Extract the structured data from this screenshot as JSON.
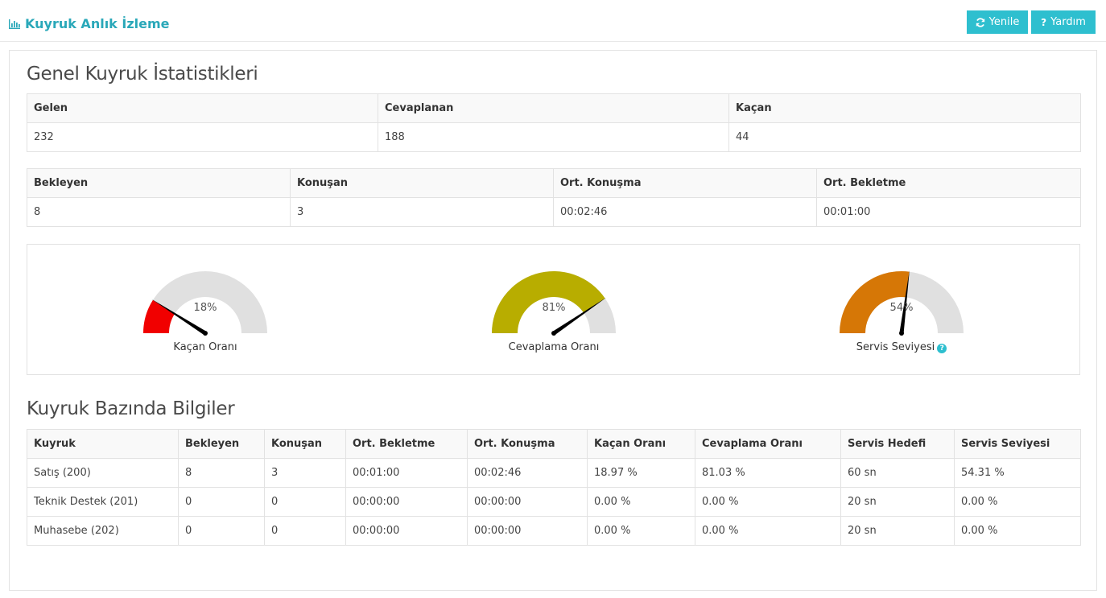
{
  "header": {
    "title": "Kuyruk Anlık İzleme",
    "title_icon": "bar-chart-icon",
    "refresh_label": "Yenile",
    "help_label": "Yardım"
  },
  "general": {
    "title": "Genel Kuyruk İstatistikleri",
    "table1": {
      "headers": [
        "Gelen",
        "Cevaplanan",
        "Kaçan"
      ],
      "values": [
        "232",
        "188",
        "44"
      ]
    },
    "table2": {
      "headers": [
        "Bekleyen",
        "Konuşan",
        "Ort. Konuşma",
        "Ort. Bekletme"
      ],
      "values": [
        "8",
        "3",
        "00:02:46",
        "00:01:00"
      ]
    }
  },
  "gauges": [
    {
      "label": "Kaçan Oranı",
      "value_text": "18%",
      "value": 0.18,
      "color": "#f10000",
      "has_help": false
    },
    {
      "label": "Cevaplama Oranı",
      "value_text": "81%",
      "value": 0.81,
      "color": "#b8ad00",
      "has_help": false
    },
    {
      "label": "Servis Seviyesi",
      "value_text": "54%",
      "value": 0.54,
      "color": "#d67706",
      "has_help": true
    }
  ],
  "gauge_track_color": "#e0e0e0",
  "queue": {
    "title": "Kuyruk Bazında Bilgiler",
    "headers": [
      "Kuyruk",
      "Bekleyen",
      "Konuşan",
      "Ort. Bekletme",
      "Ort. Konuşma",
      "Kaçan Oranı",
      "Cevaplama Oranı",
      "Servis Hedefi",
      "Servis Seviyesi"
    ],
    "rows": [
      [
        "Satış (200)",
        "8",
        "3",
        "00:01:00",
        "00:02:46",
        "18.97 %",
        "81.03 %",
        "60 sn",
        "54.31 %"
      ],
      [
        "Teknik Destek (201)",
        "0",
        "0",
        "00:00:00",
        "00:00:00",
        "0.00 %",
        "0.00 %",
        "20 sn",
        "0.00 %"
      ],
      [
        "Muhasebe (202)",
        "0",
        "0",
        "00:00:00",
        "00:00:00",
        "0.00 %",
        "0.00 %",
        "20 sn",
        "0.00 %"
      ]
    ]
  },
  "accent_color": "#2ebfcf"
}
